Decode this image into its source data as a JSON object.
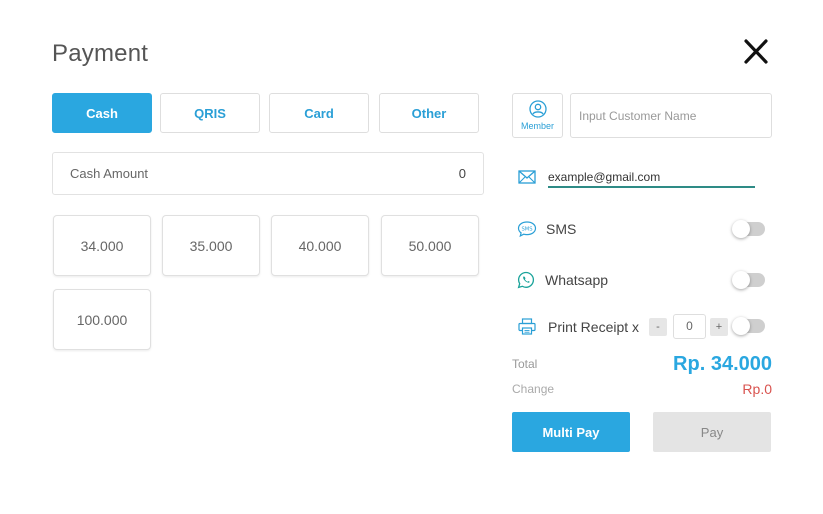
{
  "title": "Payment",
  "tabs": [
    {
      "label": "Cash",
      "active": true
    },
    {
      "label": "QRIS",
      "active": false
    },
    {
      "label": "Card",
      "active": false
    },
    {
      "label": "Other",
      "active": false
    }
  ],
  "cash_amount": {
    "label": "Cash Amount",
    "value": "0"
  },
  "quick_amounts": [
    "34.000",
    "35.000",
    "40.000",
    "50.000",
    "100.000"
  ],
  "member": {
    "label": "Member"
  },
  "customer": {
    "placeholder": "Input Customer Name",
    "value": ""
  },
  "email": {
    "value": "example@gmail.com"
  },
  "sms": {
    "label": "SMS",
    "enabled": false
  },
  "whatsapp": {
    "label": "Whatsapp",
    "enabled": false
  },
  "print_receipt": {
    "label": "Print Receipt x",
    "minus": "-",
    "plus": "+",
    "count": "0",
    "enabled": false
  },
  "summary": {
    "total_label": "Total",
    "total_value": "Rp. 34.000",
    "change_label": "Change",
    "change_value": "Rp.0"
  },
  "actions": {
    "multi_pay": "Multi Pay",
    "pay": "Pay"
  },
  "colors": {
    "accent": "#2aa7e0",
    "change": "#d9534f",
    "email_underline": "#2e8b86",
    "whatsapp": "#1aa39a"
  }
}
